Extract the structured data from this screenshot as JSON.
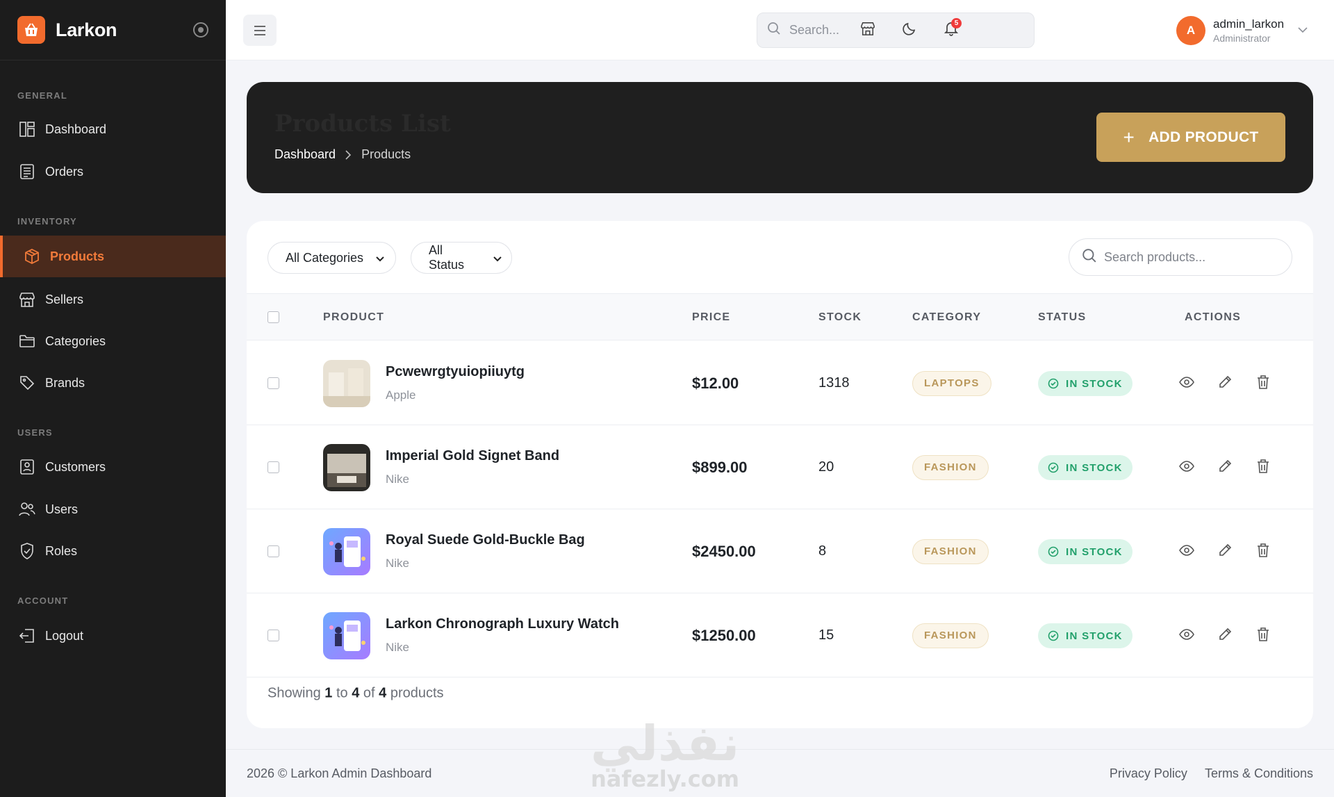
{
  "brand": {
    "name": "Larkon",
    "accent": "#f26b2d"
  },
  "sidebar": {
    "sections": [
      {
        "title": "GENERAL"
      },
      {
        "title": "INVENTORY"
      },
      {
        "title": "USERS"
      },
      {
        "title": "ACCOUNT"
      }
    ],
    "items": [
      {
        "label": "Dashboard",
        "icon": "dashboard-icon"
      },
      {
        "label": "Orders",
        "icon": "orders-icon"
      },
      {
        "label": "Products",
        "icon": "box-icon",
        "active": true
      },
      {
        "label": "Sellers",
        "icon": "store-icon"
      },
      {
        "label": "Categories",
        "icon": "folder-icon"
      },
      {
        "label": "Brands",
        "icon": "tag-icon"
      },
      {
        "label": "Customers",
        "icon": "customer-icon"
      },
      {
        "label": "Users",
        "icon": "users-icon"
      },
      {
        "label": "Roles",
        "icon": "shield-icon"
      },
      {
        "label": "Logout",
        "icon": "logout-icon"
      }
    ]
  },
  "topbar": {
    "search_placeholder": "Search...",
    "notifications_count": "5",
    "user": {
      "initial": "A",
      "name": "admin_larkon",
      "role": "Administrator"
    }
  },
  "header": {
    "title": "Products List",
    "breadcrumb": {
      "home": "Dashboard",
      "current": "Products"
    },
    "add_button": {
      "plus": "+",
      "label": "ADD PRODUCT"
    }
  },
  "filters": {
    "category": "All Categories",
    "status": "All Status",
    "search_placeholder": "Search products..."
  },
  "table": {
    "columns": [
      "PRODUCT",
      "PRICE",
      "STOCK",
      "CATEGORY",
      "STATUS",
      "ACTIONS"
    ],
    "rows": [
      {
        "name": "Pcwewrgtyuiopiiuytg",
        "brand": "Apple",
        "price": "$12.00",
        "stock": "1318",
        "category": "LAPTOPS",
        "status": "IN STOCK",
        "thumb": "beige"
      },
      {
        "name": "Imperial Gold Signet Band",
        "brand": "Nike",
        "price": "$899.00",
        "stock": "20",
        "category": "FASHION",
        "status": "IN STOCK",
        "thumb": "room"
      },
      {
        "name": "Royal Suede Gold-Buckle Bag",
        "brand": "Nike",
        "price": "$2450.00",
        "stock": "8",
        "category": "FASHION",
        "status": "IN STOCK",
        "thumb": "phone"
      },
      {
        "name": "Larkon Chronograph Luxury Watch",
        "brand": "Nike",
        "price": "$1250.00",
        "stock": "15",
        "category": "FASHION",
        "status": "IN STOCK",
        "thumb": "phone"
      }
    ]
  },
  "pagination": {
    "prefix": "Showing",
    "from": "1",
    "to_word": "to",
    "to": "4",
    "of_word": "of",
    "total": "4",
    "suffix": "products"
  },
  "footer": {
    "copyright": "2026 © Larkon Admin Dashboard",
    "links": [
      "Privacy Policy",
      "Terms & Conditions"
    ]
  },
  "watermark": {
    "arabic": "نفذلي",
    "latin": "nafezly.com"
  }
}
